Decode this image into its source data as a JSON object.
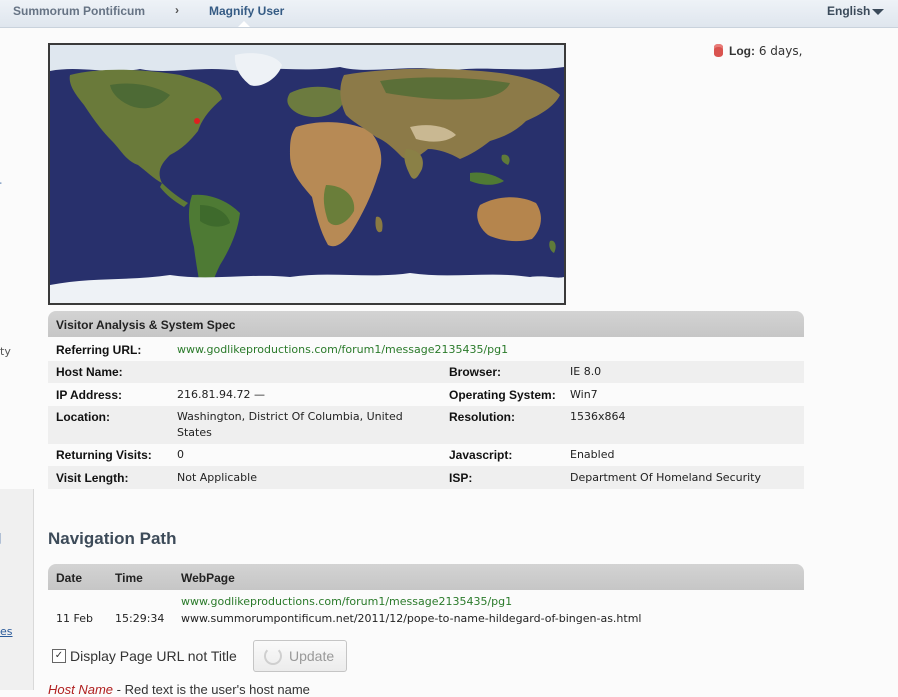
{
  "breadcrumb": {
    "site": "Summorum Pontificum",
    "separator": "›",
    "current": "Magnify User"
  },
  "language": {
    "label": "English",
    "icon": "caret-down-icon"
  },
  "left_edge_fragments": [
    "ty",
    "es"
  ],
  "log": {
    "label": "Log:",
    "value": "6 days,",
    "icon": "database-icon"
  },
  "map": {
    "marker_color": "#e02020"
  },
  "visitor": {
    "heading": "Visitor Analysis & System Spec",
    "referring_url_label": "Referring URL:",
    "referring_url": "www.godlikeproductions.com/forum1/message2135435/pg1",
    "host_name_label": "Host Name:",
    "host_name": "",
    "browser_label": "Browser:",
    "browser": "IE 8.0",
    "ip_label": "IP Address:",
    "ip": "216.81.94.72 —",
    "os_label": "Operating System:",
    "os": "Win7",
    "location_label": "Location:",
    "location_line1": "Washington, District Of Columbia, United",
    "location_line2": "States",
    "resolution_label": "Resolution:",
    "resolution": "1536x864",
    "returning_label": "Returning Visits:",
    "returning": "0",
    "javascript_label": "Javascript:",
    "javascript": "Enabled",
    "visit_length_label": "Visit Length:",
    "visit_length": "Not Applicable",
    "isp_label": "ISP:",
    "isp": "Department Of Homeland Security"
  },
  "navigation": {
    "title": "Navigation Path",
    "columns": [
      "Date",
      "Time",
      "WebPage"
    ],
    "rows": [
      {
        "date": "11 Feb",
        "time": "15:29:34",
        "referrer": "www.godlikeproductions.com/forum1/message2135435/pg1",
        "page": "www.summorumpontificum.net/2011/12/pope-to-name-hildegard-of-bingen-as.html"
      }
    ]
  },
  "controls": {
    "checkbox_label": "Display Page URL not Title",
    "checkbox_checked": true,
    "checkbox_mark": "✓",
    "update_label": "Update"
  },
  "legend": {
    "host_name": "Host Name",
    "text": " - Red text is the user's host name"
  },
  "colors": {
    "accent": "#355b84",
    "link_green": "#2a7a2a",
    "header_gray": "#c6c6c6",
    "map_ocean": "#28306c"
  }
}
